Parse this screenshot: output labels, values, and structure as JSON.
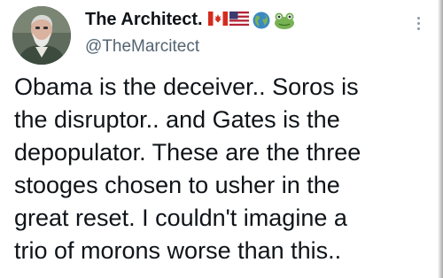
{
  "author": {
    "display_name": "The Architect.",
    "handle": "@TheMarcitect",
    "name_emojis": [
      "canada-flag-icon",
      "us-flag-icon",
      "globe-icon",
      "frog-icon"
    ]
  },
  "tweet": {
    "text": "Obama is the deceiver.. Soros is\nthe disruptor.. and Gates is the\ndepopulator. These are the three\nstooges chosen to usher in the\ngreat reset. I couldn't imagine a\ntrio of morons worse than this.."
  },
  "colors": {
    "text_primary": "#0f1419",
    "text_secondary": "#536471",
    "background": "#ffffff"
  }
}
